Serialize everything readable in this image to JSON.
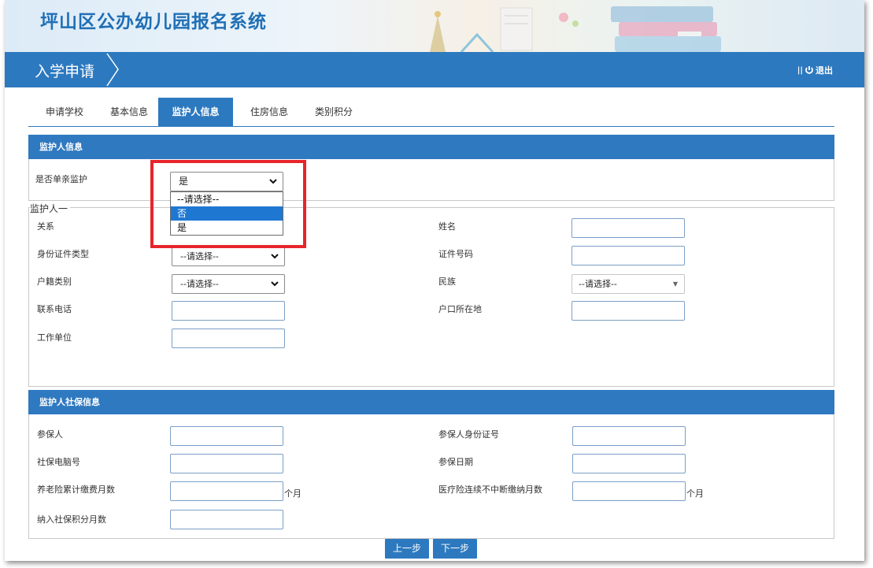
{
  "header": {
    "title": "坪山区公办幼儿园报名系统"
  },
  "navbar": {
    "title": "入学申请",
    "logout_label": "退出"
  },
  "tabs": [
    {
      "label": "申请学校",
      "active": false
    },
    {
      "label": "基本信息",
      "active": false
    },
    {
      "label": "监护人信息",
      "active": true
    },
    {
      "label": "住房信息",
      "active": false
    },
    {
      "label": "类别积分",
      "active": false
    }
  ],
  "guardian_section": {
    "heading": "监护人信息",
    "single_parent_label": "是否单亲监护",
    "single_parent_value": "是",
    "dropdown_options": [
      {
        "label": "--请选择--",
        "highlighted": false
      },
      {
        "label": "否",
        "highlighted": true
      },
      {
        "label": "是",
        "highlighted": false
      }
    ]
  },
  "guardian1": {
    "legend": "监护人一",
    "relation_label": "关系",
    "name_label": "姓名",
    "name_value": "",
    "id_type_label": "身份证件类型",
    "id_type_value": "--请选择--",
    "id_number_label": "证件号码",
    "id_number_value": "",
    "household_type_label": "户籍类别",
    "household_type_value": "--请选择--",
    "ethnicity_label": "民族",
    "ethnicity_value": "--请选择--",
    "phone_label": "联系电话",
    "phone_value": "",
    "hukou_location_label": "户口所在地",
    "hukou_location_value": "",
    "employer_label": "工作单位",
    "employer_value": ""
  },
  "social_security": {
    "heading": "监护人社保信息",
    "insured_label": "参保人",
    "insured_id_label": "参保人身份证号",
    "computer_no_label": "社保电脑号",
    "insured_date_label": "参保日期",
    "pension_months_label": "养老险累计缴费月数",
    "medical_months_label": "医疗险连续不中断缴纳月数",
    "months_suffix": "个月",
    "points_months_label": "纳入社保积分月数"
  },
  "footer": {
    "prev_label": "上一步",
    "next_label": "下一步"
  },
  "colors": {
    "primary": "#2d79bf",
    "highlight": "#e8242b",
    "title": "#1f6fb5"
  }
}
